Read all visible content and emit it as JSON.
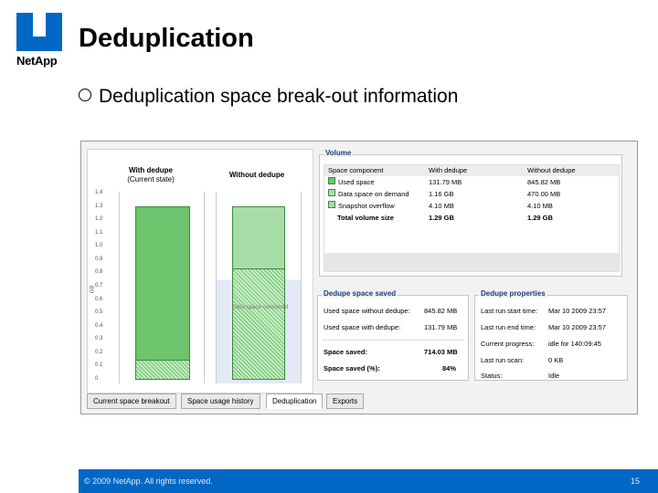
{
  "brand": {
    "logo_text": "NetApp",
    "color": "#0067c5"
  },
  "slide": {
    "title": "Deduplication",
    "bullet": "Deduplication space break-out information",
    "copyright": "© 2009 NetApp.  All rights reserved.",
    "page_number": "15"
  },
  "screenshot": {
    "chart": {
      "col1_title": "With dedupe",
      "col1_sub": "(Current state)",
      "col2_title": "Without dedupe",
      "ylabel": "GB",
      "ticks": [
        "1.4",
        "1.3",
        "1.2",
        "1.1",
        "1.0",
        "0.9",
        "0.8",
        "0.7",
        "0.6",
        "0.5",
        "0.4",
        "0.3",
        "0.2",
        "0.1",
        "0"
      ],
      "col2_note": "Extra space consumed"
    },
    "tabs": [
      "Current space breakout",
      "Space usage history",
      "Deduplication",
      "Exports"
    ],
    "volume": {
      "legend": "Volume",
      "headers": [
        "Space component",
        "With dedupe",
        "Without dedupe"
      ],
      "rows": [
        {
          "name": "Used space",
          "with": "131.79 MB",
          "without": "845.82 MB",
          "swatch": "#6cc46c"
        },
        {
          "name": "Data space on demand",
          "with": "1.16 GB",
          "without": "470.00 MB",
          "swatch": "#a8dca8"
        },
        {
          "name": "Snapshot overflow",
          "with": "4.10 MB",
          "without": "4.10 MB",
          "swatch": "hatch"
        }
      ],
      "total": {
        "name": "Total volume size",
        "with": "1.29 GB",
        "without": "1.29 GB"
      }
    },
    "dedupe_saved": {
      "legend": "Dedupe space saved",
      "used_without_label": "Used space without dedupe:",
      "used_without_value": "845.82 MB",
      "used_with_label": "Used space with dedupe:",
      "used_with_value": "131.79 MB",
      "saved_label": "Space saved:",
      "saved_value": "714.03 MB",
      "saved_pct_label": "Space saved (%):",
      "saved_pct_value": "84%"
    },
    "dedupe_props": {
      "legend": "Dedupe properties",
      "start_label": "Last run start time:",
      "start_value": "Mar 10 2009 23:57",
      "end_label": "Last run end time:",
      "end_value": "Mar 10 2009 23:57",
      "progress_label": "Current progress:",
      "progress_value": "idle for 140:09:45",
      "size_label": "Last run scan:",
      "size_value": "0 KB",
      "status_label": "Status:",
      "status_value": "Idle"
    }
  }
}
